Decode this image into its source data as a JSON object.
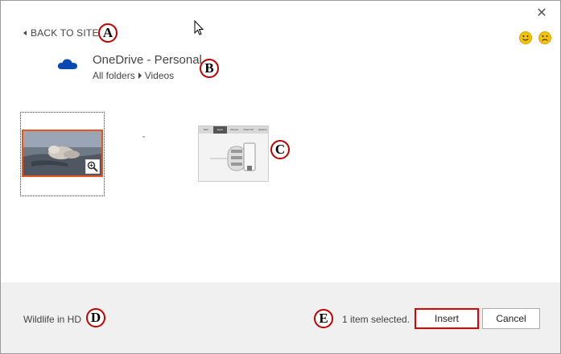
{
  "header": {
    "back_label": "BACK TO SITES",
    "close_icon": "close-icon",
    "feedback_icons": [
      "smile-icon",
      "frown-icon"
    ]
  },
  "site": {
    "title": "OneDrive - Personal",
    "icon": "onedrive-cloud-icon",
    "breadcrumb": [
      "All folders",
      "Videos"
    ]
  },
  "thumbnails": [
    {
      "name": "Wildlife in HD",
      "selected": true
    },
    {
      "name": "",
      "selected": false
    }
  ],
  "thumbnail_tabs": [
    "Start",
    "Apply",
    "Choose",
    "Select all",
    "Options"
  ],
  "footer": {
    "selected_name": "Wildlife in HD",
    "status": "1 item selected.",
    "insert_label": "Insert",
    "cancel_label": "Cancel"
  },
  "callouts": {
    "a": "A",
    "b": "B",
    "c": "C",
    "d": "D",
    "e": "E"
  },
  "colors": {
    "accent_red": "#e00000",
    "selection_orange": "#e8531f",
    "onedrive_blue": "#094ab2"
  }
}
